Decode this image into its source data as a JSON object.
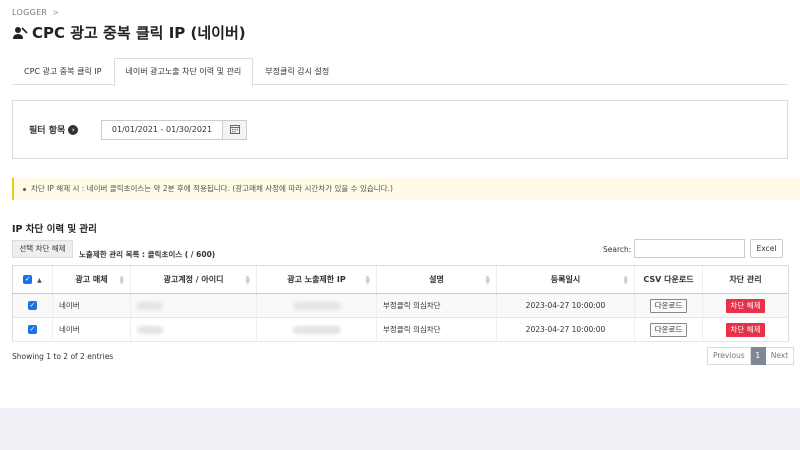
{
  "breadcrumb": {
    "root": "LOGGER",
    "separator": ">"
  },
  "page": {
    "title": "CPC 광고 중복 클릭 IP (네이버)"
  },
  "tabs": [
    {
      "label": "CPC 광고 중복 클릭 IP",
      "active": false
    },
    {
      "label": "네이버 광고노출 차단 이력 및 관리",
      "active": true
    },
    {
      "label": "부정클릭 감시 설정",
      "active": false
    }
  ],
  "filter": {
    "label": "필터 항목",
    "date_range": "01/01/2021 - 01/30/2021"
  },
  "notice": {
    "text": "차단 IP 해제 시 : 네이버 클릭초이스는 약 2분 후에 적용됩니다. (광고매체 사정에 따라 시간차가 있을 수 있습니다.)"
  },
  "section": {
    "title": "IP 차단 이력 및 관리"
  },
  "toolbar": {
    "release_selected_label": "선택 차단 해제",
    "list_info": "노출제한 관리 목록 : 클릭초이스 (   / 600)",
    "search_label": "Search:",
    "search_value": "",
    "excel_label": "Excel"
  },
  "table": {
    "columns": [
      "",
      "광고 매체",
      "광고계정 / 아이디",
      "광고 노출제한 IP",
      "설명",
      "등록일시",
      "CSV 다운로드",
      "차단 관리"
    ],
    "rows": [
      {
        "checked": true,
        "media": "네이버",
        "account": "",
        "ip": "",
        "description": "부정클릭 의심차단",
        "registered": "2023-04-27 10:00:00",
        "download_label": "다운로드",
        "unblock_label": "차단 해제"
      },
      {
        "checked": true,
        "media": "네이버",
        "account": "",
        "ip": "",
        "description": "부정클릭 의심차단",
        "registered": "2023-04-27 10:00:00",
        "download_label": "다운로드",
        "unblock_label": "차단 해제"
      }
    ]
  },
  "footer": {
    "entries_text": "Showing 1 to 2 of 2 entries",
    "pagination": {
      "previous": "Previous",
      "current": "1",
      "next": "Next"
    }
  },
  "colors": {
    "accent_red": "#e8324a",
    "checkbox_blue": "#1a73e8",
    "notice_bg": "#fffbe6",
    "page_current": "#7d8a96"
  },
  "icons": {
    "title": "user-block-icon",
    "filter": "arrow-circle-right-icon",
    "calendar": "calendar-icon"
  }
}
